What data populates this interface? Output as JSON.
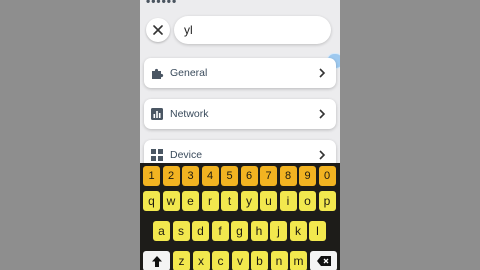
{
  "header": {
    "partial_text": "••••••"
  },
  "search": {
    "value": "yl",
    "clear_icon": "close-icon"
  },
  "menu": [
    {
      "label": "General",
      "icon": "puzzle-icon"
    },
    {
      "label": "Network",
      "icon": "bar-chart-icon"
    },
    {
      "label": "Device",
      "icon": "grid-icon"
    }
  ],
  "keyboard": {
    "number_row": [
      "1",
      "2",
      "3",
      "4",
      "5",
      "6",
      "7",
      "8",
      "9",
      "0"
    ],
    "row1": [
      "q",
      "w",
      "e",
      "r",
      "t",
      "y",
      "u",
      "i",
      "o",
      "p"
    ],
    "row2": [
      "a",
      "s",
      "d",
      "f",
      "g",
      "h",
      "j",
      "k",
      "l"
    ],
    "row3": [
      "z",
      "x",
      "c",
      "v",
      "b",
      "n",
      "m"
    ],
    "shift_icon": "shift-arrow-icon",
    "backspace_icon": "backspace-icon"
  },
  "colors": {
    "number_key": "#f2b321",
    "letter_key": "#f2e84e",
    "keyboard_bg": "#1d1c19",
    "screen_bg": "#ececee"
  }
}
